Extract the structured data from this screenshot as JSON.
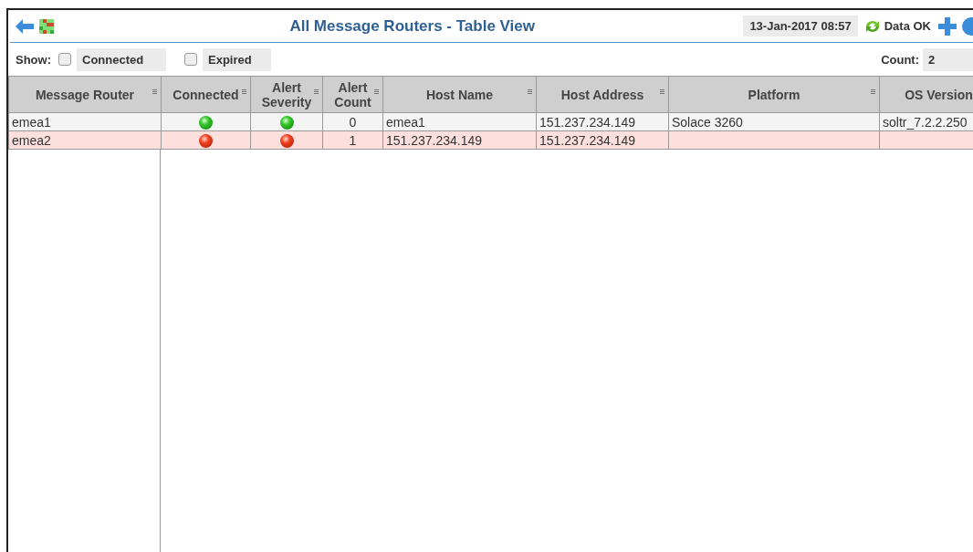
{
  "header": {
    "title": "All Message Routers - Table View",
    "timestamp": "13-Jan-2017 08:57",
    "data_status": "Data OK"
  },
  "filters": {
    "label": "Show:",
    "options": [
      {
        "label": "Connected",
        "checked": false
      },
      {
        "label": "Expired",
        "checked": false
      }
    ],
    "count_label": "Count:",
    "count": "2"
  },
  "table": {
    "columns": [
      "Message Router",
      "Connected",
      "Alert Severity",
      "Alert Count",
      "Host Name",
      "Host Address",
      "Platform",
      "OS Version"
    ],
    "rows": [
      {
        "highlighted": false,
        "message_router": "emea1",
        "connected": true,
        "alerting": false,
        "alert_count": "0",
        "host_name": "emea1",
        "host_address": "151.237.234.149",
        "platform": "Solace 3260",
        "os_version": "soltr_7.2.2.250"
      },
      {
        "highlighted": true,
        "message_router": "emea2",
        "connected": false,
        "alerting": true,
        "alert_count": "1",
        "host_name": "151.237.234.149",
        "host_address": "151.237.234.149",
        "platform": "",
        "os_version": ""
      }
    ]
  }
}
